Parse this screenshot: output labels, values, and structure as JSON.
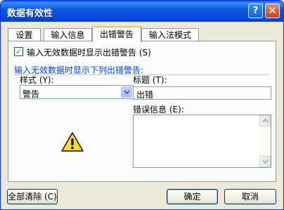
{
  "window": {
    "title": "数据有效性"
  },
  "titlebar": {
    "help_label": "?",
    "close_label": "✕"
  },
  "tabs": [
    {
      "label": "设置"
    },
    {
      "label": "输入信息"
    },
    {
      "label": "出错警告"
    },
    {
      "label": "输入法模式"
    }
  ],
  "panel": {
    "show_error_checkbox": {
      "checked": true,
      "label": "输入无效数据时显示出错警告 (S)"
    },
    "group_label": "输入无效数据时显示下列出错警告:",
    "style": {
      "label": "样式 (Y):",
      "value": "警告"
    },
    "title_field": {
      "label": "标题 (T):",
      "value": "出错"
    },
    "error_message": {
      "label": "错误信息 (E):",
      "value": ""
    },
    "icon": "warning-triangle-icon"
  },
  "buttons": {
    "clear_all": "全部清除 (C)",
    "ok": "确定",
    "cancel": "取消"
  }
}
